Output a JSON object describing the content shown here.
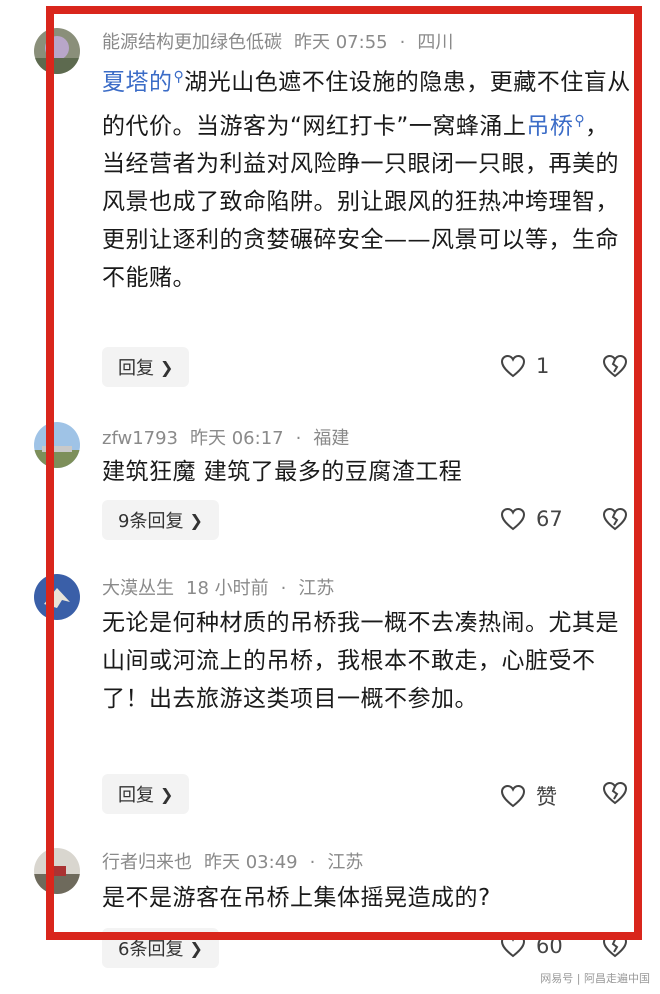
{
  "comments": [
    {
      "username": "能源结构更加绿色低碳",
      "time": "昨天 07:55",
      "location": "四川",
      "text_parts": [
        "夏塔的",
        "湖光山色遮不住设施的隐患，更藏不住盲从的代价。当游客为“网红打卡”一窝蜂涌上",
        "吊桥",
        "，当经营者为利益对风险睁一只眼闭一只眼，再美的风景也成了致命陷阱。别让跟风的狂热冲垮理智，更别让逐利的贪婪碾碎安全——风景可以等，生命不能赌。"
      ],
      "reply_label": "回复",
      "like_count": "1"
    },
    {
      "username": "zfw1793",
      "time": "昨天 06:17",
      "location": "福建",
      "text": "建筑狂魔 建筑了最多的豆腐渣工程",
      "reply_label": "9条回复",
      "like_count": "67"
    },
    {
      "username": "大漠丛生",
      "time": "18 小时前",
      "location": "江苏",
      "text": "无论是何种材质的吊桥我一概不去凑热闹。尤其是山间或河流上的吊桥，我根本不敢走，心脏受不了！出去旅游这类项目一概不参加。",
      "reply_label": "回复",
      "like_count": "赞"
    },
    {
      "username": "行者归来也",
      "time": "昨天 03:49",
      "location": "江苏",
      "text": "是不是游客在吊桥上集体摇晃造成的?",
      "reply_label": "6条回复",
      "like_count": "60"
    }
  ],
  "separator": "·",
  "watermark": "网易号 | 阿昌走遍中国",
  "colors": {
    "accent_frame": "#d9261c",
    "mention": "#3b6cc7",
    "meta": "#8a8a8a"
  }
}
